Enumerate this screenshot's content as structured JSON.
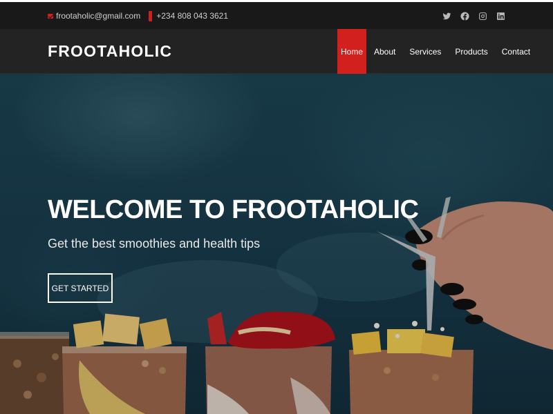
{
  "topbar": {
    "email": "frootaholic@gmail.com",
    "phone": "+234 808 043 3621",
    "social_icons": [
      "twitter-icon",
      "facebook-icon",
      "instagram-icon",
      "linkedin-icon"
    ]
  },
  "header": {
    "logo": "FROOTAHOLIC",
    "nav": [
      {
        "label": "Home",
        "active": true
      },
      {
        "label": "About"
      },
      {
        "label": "Services"
      },
      {
        "label": "Products"
      },
      {
        "label": "Contact"
      }
    ]
  },
  "hero": {
    "title": "WELCOME TO FROOTAHOLIC",
    "subtitle": "Get the best smoothies and health tips",
    "cta_label": "GET STARTED"
  },
  "colors": {
    "accent": "#d2201e",
    "topbar_bg": "#191919",
    "header_bg": "#232323",
    "hero_bg": "#1a3f50"
  }
}
